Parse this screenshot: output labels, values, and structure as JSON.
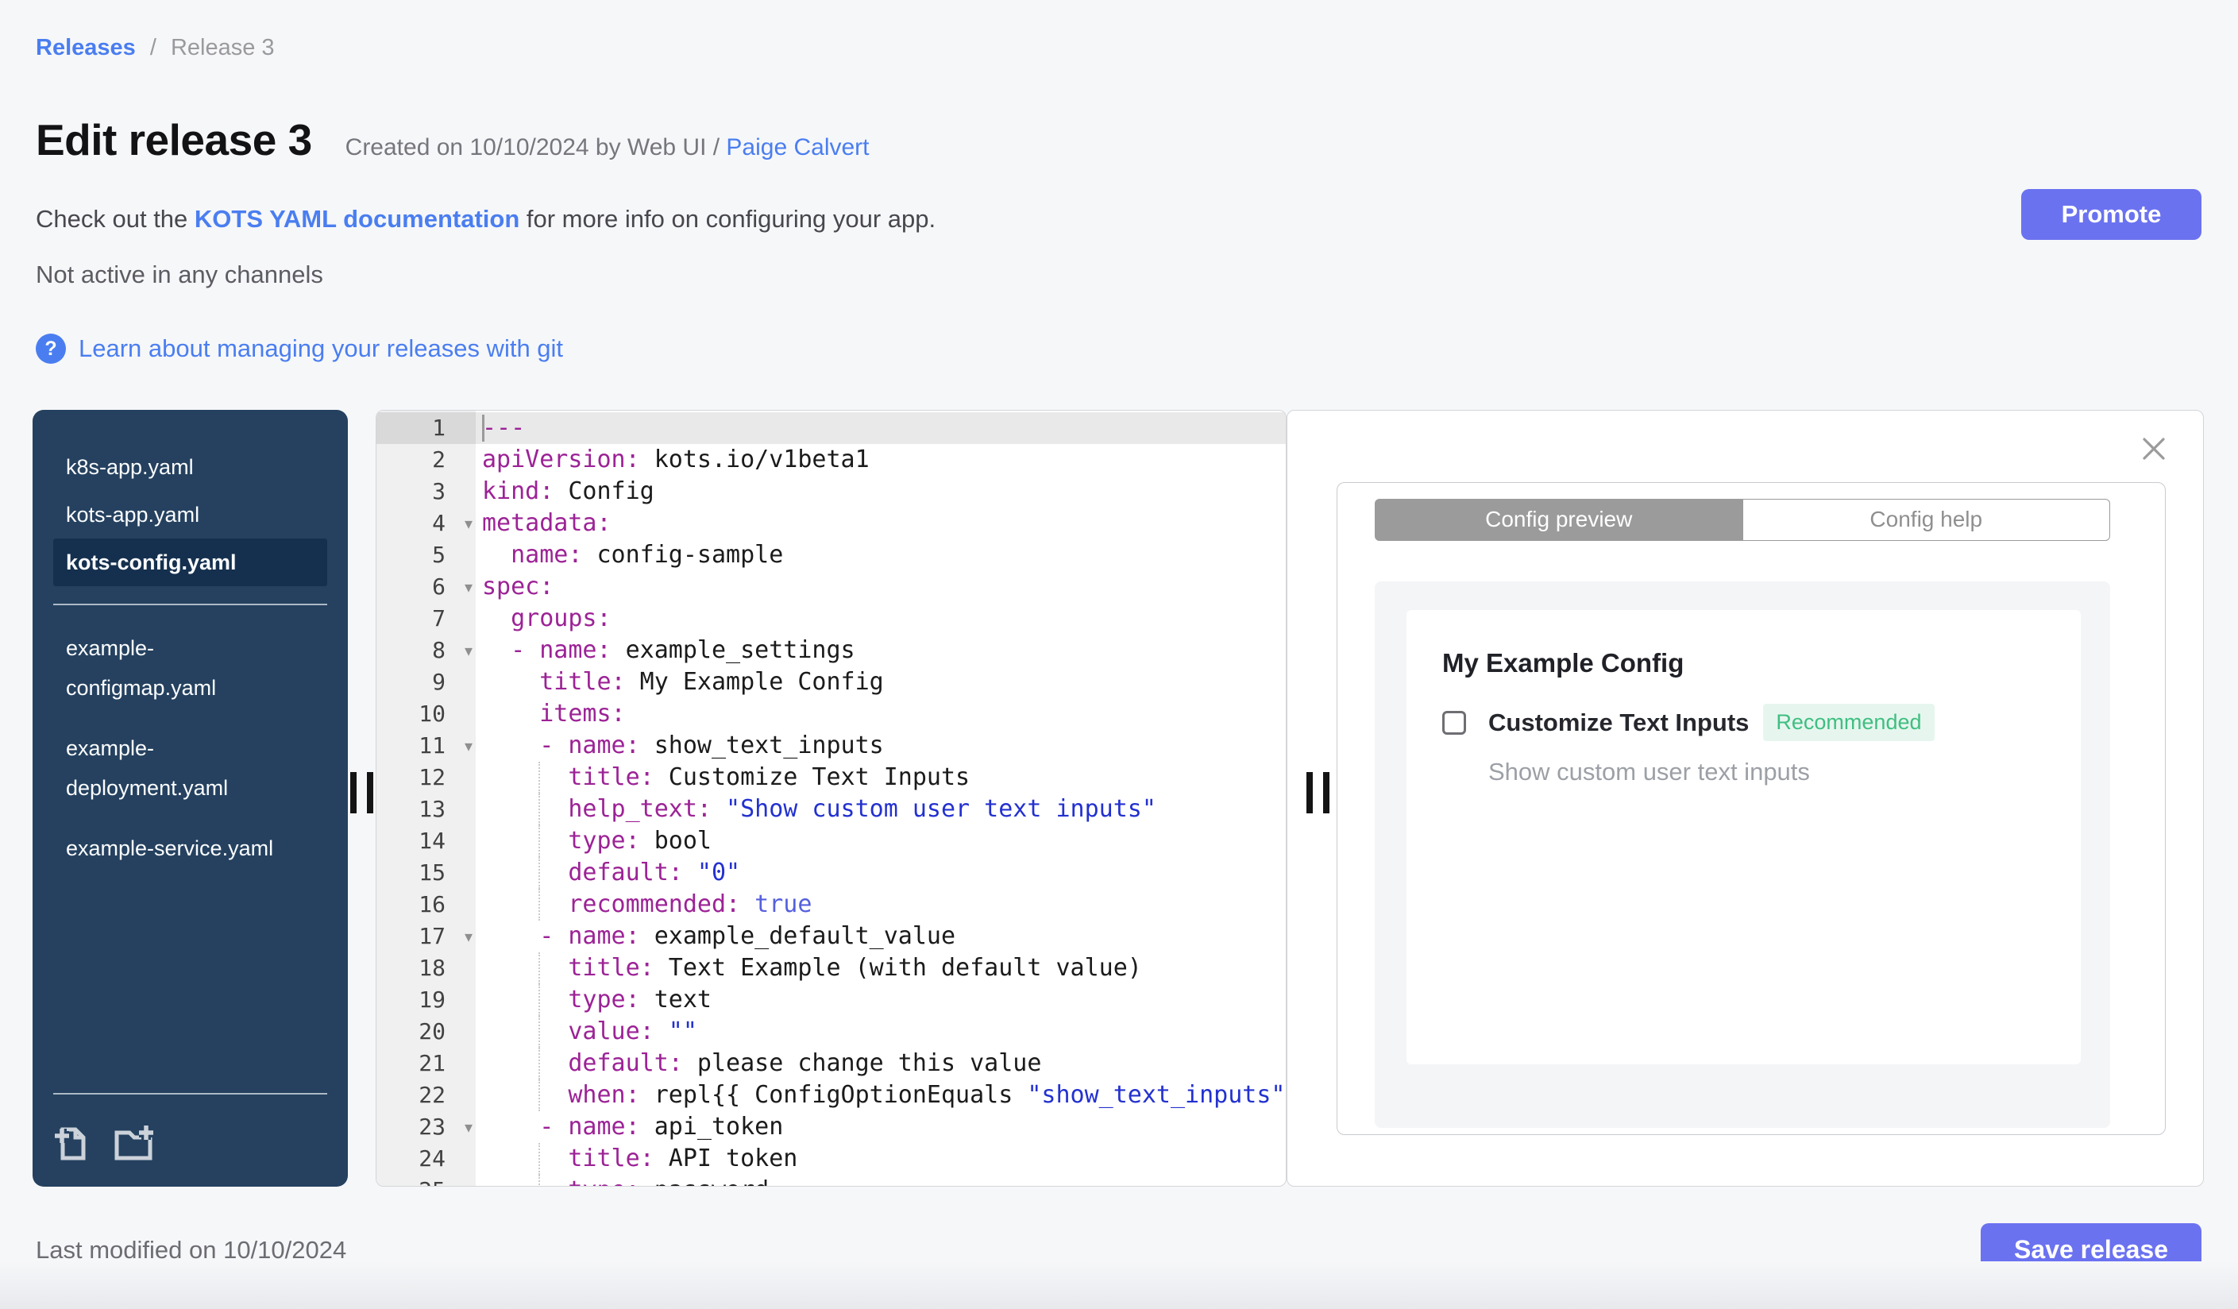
{
  "header": {
    "breadcrumb": {
      "parent": "Releases",
      "separator": "/",
      "current": "Release 3"
    },
    "title": "Edit release 3",
    "created_prefix": "Created on 10/10/2024 by Web UI / ",
    "created_author": "Paige Calvert",
    "doc_before": "Check out the ",
    "doc_link": "KOTS YAML documentation",
    "doc_after": " for more info on configuring your app.",
    "channel_status": "Not active in any channels",
    "help_icon": "?",
    "git_link": "Learn about managing your releases with git",
    "promote_label": "Promote"
  },
  "file_tree": {
    "selected": "kots-config.yaml",
    "groups": [
      [
        "k8s-app.yaml",
        "kots-app.yaml",
        "kots-config.yaml"
      ],
      [
        "example-configmap.yaml",
        "example-deployment.yaml",
        "example-service.yaml"
      ]
    ],
    "actions": [
      "add-file",
      "add-folder"
    ]
  },
  "editor": {
    "language": "yaml",
    "active_line": 1,
    "folded_lines": [
      4,
      6,
      8,
      11,
      17,
      23
    ],
    "guide_lines": [
      12,
      13,
      14,
      15,
      16,
      18,
      19,
      20,
      21,
      22,
      24,
      25
    ],
    "lines": [
      [
        [
          "k",
          "---"
        ]
      ],
      [
        [
          "k",
          "apiVersion:"
        ],
        [
          "v",
          " kots.io/v1beta1"
        ]
      ],
      [
        [
          "k",
          "kind:"
        ],
        [
          "v",
          " Config"
        ]
      ],
      [
        [
          "k",
          "metadata:"
        ]
      ],
      [
        [
          "k",
          "  name:"
        ],
        [
          "v",
          " config-sample"
        ]
      ],
      [
        [
          "k",
          "spec:"
        ]
      ],
      [
        [
          "k",
          "  groups:"
        ]
      ],
      [
        [
          "k",
          "  - name:"
        ],
        [
          "v",
          " example_settings"
        ]
      ],
      [
        [
          "k",
          "    title:"
        ],
        [
          "v",
          " My Example Config"
        ]
      ],
      [
        [
          "k",
          "    items:"
        ]
      ],
      [
        [
          "k",
          "    - name:"
        ],
        [
          "v",
          " show_text_inputs"
        ]
      ],
      [
        [
          "k",
          "      title:"
        ],
        [
          "v",
          " Customize Text Inputs"
        ]
      ],
      [
        [
          "k",
          "      help_text:"
        ],
        [
          "s",
          " \"Show custom user text inputs\""
        ]
      ],
      [
        [
          "k",
          "      type:"
        ],
        [
          "v",
          " bool"
        ]
      ],
      [
        [
          "k",
          "      default:"
        ],
        [
          "s",
          " \"0\""
        ]
      ],
      [
        [
          "k",
          "      recommended:"
        ],
        [
          "b",
          " true"
        ]
      ],
      [
        [
          "k",
          "    - name:"
        ],
        [
          "v",
          " example_default_value"
        ]
      ],
      [
        [
          "k",
          "      title:"
        ],
        [
          "v",
          " Text Example (with default value)"
        ]
      ],
      [
        [
          "k",
          "      type:"
        ],
        [
          "v",
          " text"
        ]
      ],
      [
        [
          "k",
          "      value:"
        ],
        [
          "s",
          " \"\""
        ]
      ],
      [
        [
          "k",
          "      default:"
        ],
        [
          "v",
          " please change this value"
        ]
      ],
      [
        [
          "k",
          "      when:"
        ],
        [
          "v",
          " repl{{ ConfigOptionEquals "
        ],
        [
          "s",
          "\"show_text_inputs\""
        ],
        [
          "v",
          " }}"
        ]
      ],
      [
        [
          "k",
          "    - name:"
        ],
        [
          "v",
          " api_token"
        ]
      ],
      [
        [
          "k",
          "      title:"
        ],
        [
          "v",
          " API token"
        ]
      ],
      [
        [
          "k",
          "      type:"
        ],
        [
          "v",
          " password"
        ]
      ]
    ]
  },
  "preview": {
    "tabs": [
      "Config preview",
      "Config help"
    ],
    "active_tab": "Config preview",
    "group_title": "My Example Config",
    "item": {
      "label": "Customize Text Inputs",
      "badge": "Recommended",
      "help": "Show custom user text inputs",
      "checked": false
    }
  },
  "footer": {
    "last_modified": "Last modified on 10/10/2024",
    "save_label": "Save release"
  },
  "colors": {
    "accent_button": "#6b72f0",
    "link_blue": "#4a7ef0",
    "sidebar_bg": "#25415f",
    "sidebar_selected_bg": "#15304e",
    "syntax_key": "#9c2396",
    "syntax_string": "#2331cf",
    "syntax_bool": "#5560dd",
    "badge_green_text": "#3fbe81",
    "badge_green_bg": "#e6f6ee",
    "tab_active_bg": "#9b9b9b",
    "page_bg": "#f6f7f9"
  }
}
